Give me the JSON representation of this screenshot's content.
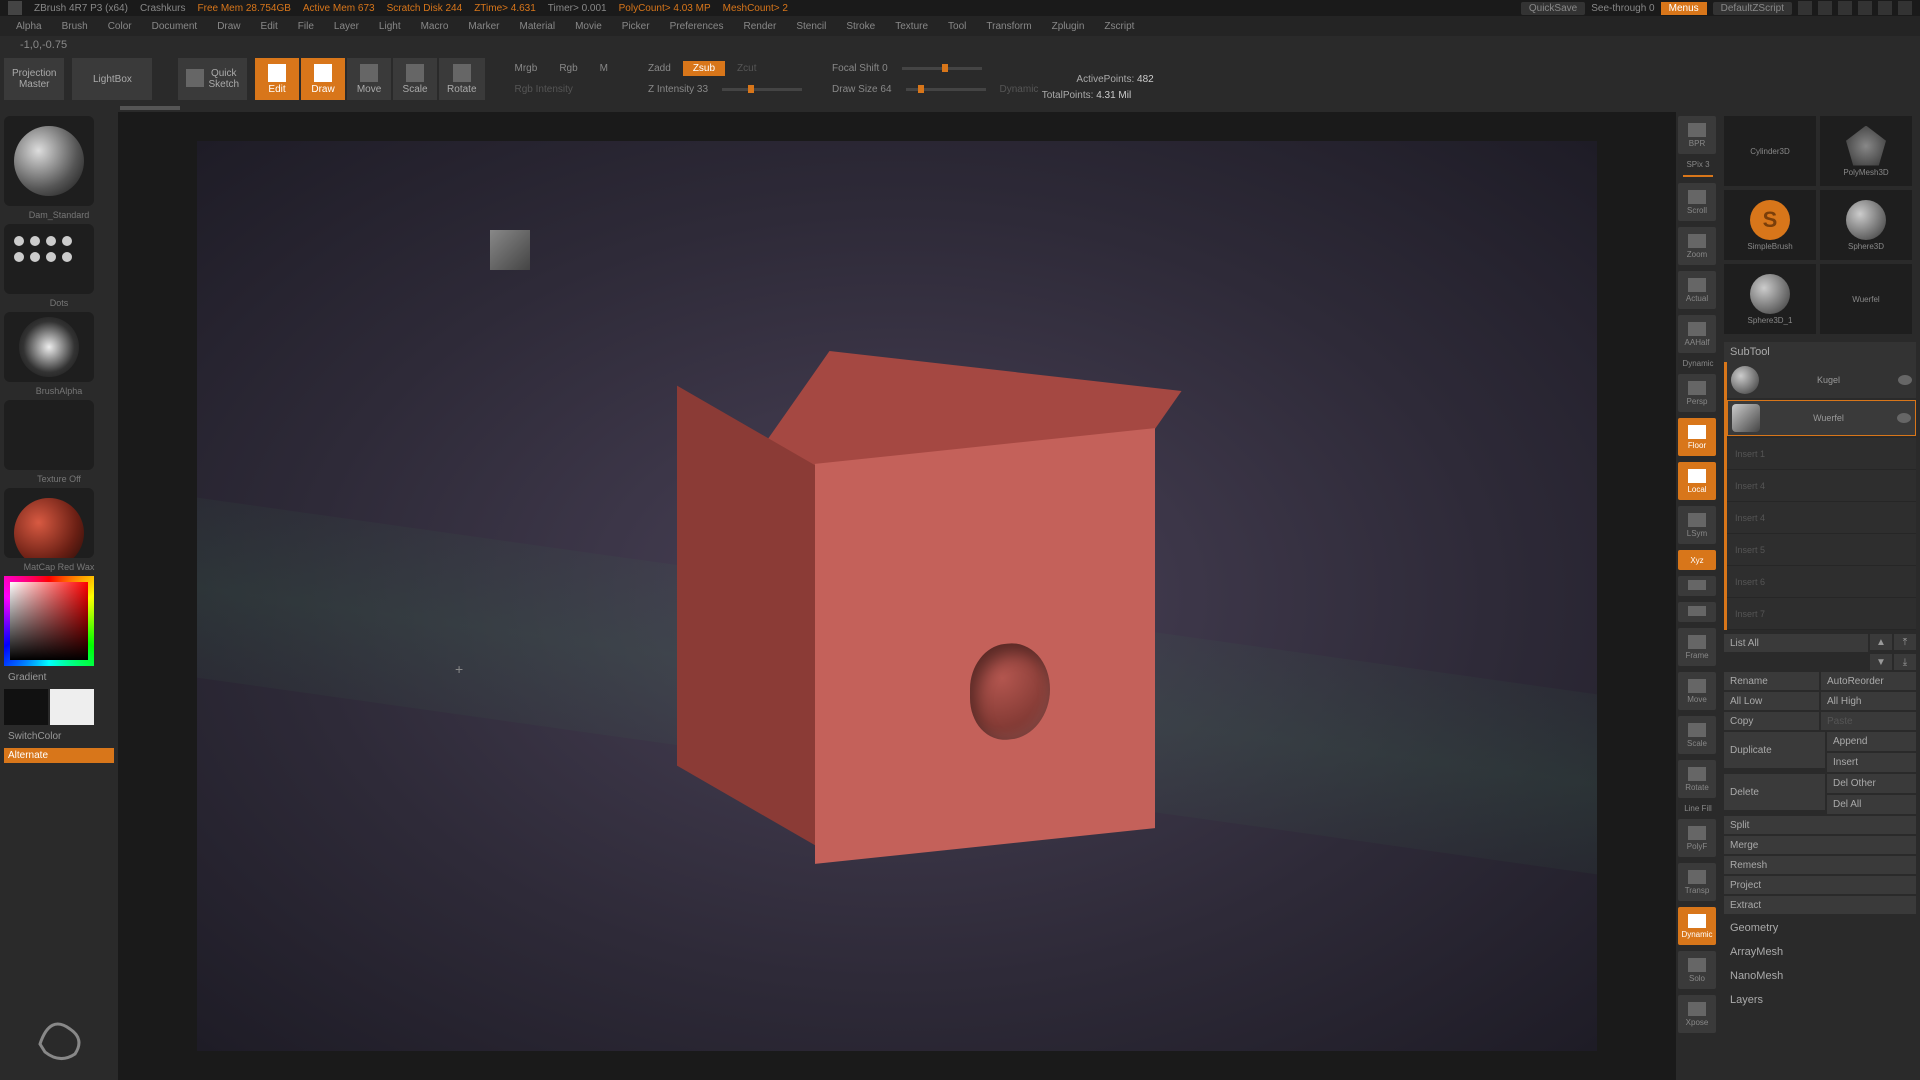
{
  "sysbar": {
    "app": "ZBrush 4R7 P3 (x64)",
    "project": "Crashkurs",
    "freemem": "Free Mem 28.754GB",
    "activemem": "Active Mem 673",
    "scratch": "Scratch Disk 244",
    "ztime": "ZTime> 4.631",
    "timer": "Timer> 0.001",
    "polycount": "PolyCount> 4.03 MP",
    "meshcount": "MeshCount> 2",
    "quicksave": "QuickSave",
    "seethrough": "See-through   0",
    "menus": "Menus",
    "script": "DefaultZScript"
  },
  "menus": [
    "Alpha",
    "Brush",
    "Color",
    "Document",
    "Draw",
    "Edit",
    "File",
    "Layer",
    "Light",
    "Macro",
    "Marker",
    "Material",
    "Movie",
    "Picker",
    "Preferences",
    "Render",
    "Stencil",
    "Stroke",
    "Texture",
    "Tool",
    "Transform",
    "Zplugin",
    "Zscript"
  ],
  "coord": "-1,0,-0.75",
  "toolbar": {
    "projection": "Projection\nMaster",
    "lightbox": "LightBox",
    "quicksketch": "Quick\nSketch",
    "edit": "Edit",
    "draw": "Draw",
    "move": "Move",
    "scale": "Scale",
    "rotate": "Rotate",
    "mrgb": "Mrgb",
    "rgb": "Rgb",
    "m": "M",
    "rgbint": "Rgb Intensity",
    "zadd": "Zadd",
    "zsub": "Zsub",
    "zcut": "Zcut",
    "zint": "Z Intensity 33",
    "focal": "Focal Shift 0",
    "drawsize": "Draw Size 64",
    "dynamic": "Dynamic",
    "active": "ActivePoints:",
    "active_n": "482",
    "total": "TotalPoints:",
    "total_n": "4.31 Mil"
  },
  "left": {
    "brush": "Dam_Standard",
    "stroke": "Dots",
    "alpha": "BrushAlpha",
    "tex": "Texture Off",
    "mat": "MatCap Red Wax",
    "gradient": "Gradient",
    "switch": "SwitchColor",
    "alternate": "Alternate"
  },
  "righticons": {
    "bpr": "BPR",
    "spix": "SPix 3",
    "scroll": "Scroll",
    "zoom": "Zoom",
    "actual": "Actual",
    "aahalf": "AAHalf",
    "dynamic": "Dynamic",
    "persp": "Persp",
    "floor": "Floor",
    "local": "Local",
    "lsym": "LSym",
    "xyz": "Xyz",
    "frame": "Frame",
    "move": "Move",
    "scale": "Scale",
    "rotate": "Rotate",
    "linefill": "Line Fill",
    "polyf": "PolyF",
    "transp": "Transp",
    "dyn2": "Dynamic",
    "solo": "Solo",
    "xpose": "Xpose"
  },
  "tools": {
    "cylinder": "Cylinder3D",
    "polymesh": "PolyMesh3D",
    "simplebrush": "SimpleBrush",
    "sphere": "Sphere3D",
    "sphere1": "Sphere3D_1",
    "wuerfel": "Wuerfel"
  },
  "subtool": {
    "header": "SubTool",
    "kugel": "Kugel",
    "wuerfel": "Wuerfel",
    "slots": [
      "Insert 1",
      "Insert 4",
      "Insert 4",
      "Insert 5",
      "Insert 6",
      "Insert 7"
    ],
    "listall": "List All",
    "rename": "Rename",
    "autoreorder": "AutoReorder",
    "alllow": "All Low",
    "allhigh": "All High",
    "copy": "Copy",
    "paste": "Paste",
    "duplicate": "Duplicate",
    "append": "Append",
    "insert": "Insert",
    "delete": "Delete",
    "delother": "Del Other",
    "delall": "Del All",
    "split": "Split",
    "merge": "Merge",
    "remesh": "Remesh",
    "project": "Project",
    "extract": "Extract",
    "geometry": "Geometry",
    "arraymesh": "ArrayMesh",
    "nanomesh": "NanoMesh",
    "layers": "Layers"
  }
}
